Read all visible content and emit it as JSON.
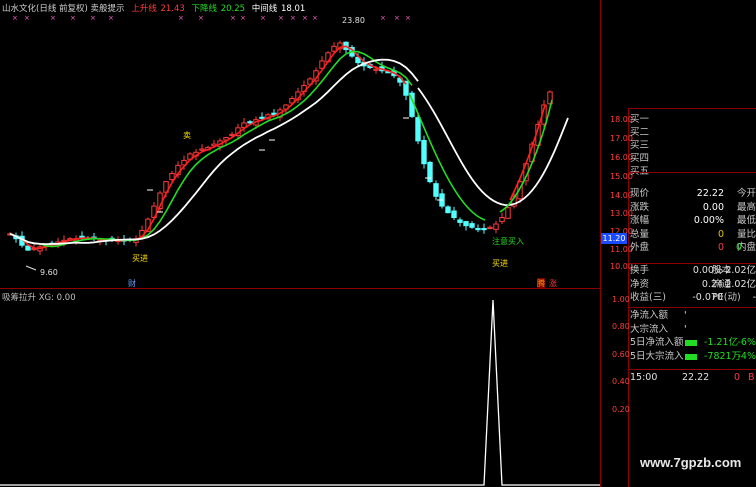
{
  "header": {
    "title": "山水文化(日线 前复权) 卖般提示",
    "upper_label": "上升线",
    "upper_value": "21.43",
    "lower_label": "下降线",
    "lower_value": "20.25",
    "mid_label": "中间线",
    "mid_value": "18.01"
  },
  "annotations": {
    "high": "23.80",
    "low": "9.60",
    "buy1": "买进",
    "buy2": "买进",
    "sell": "卖",
    "attention_buy": "注意买入",
    "fin": "财",
    "teng": "腾",
    "zhang": "涨"
  },
  "price_axis": {
    "ticks": [
      "18.00",
      "17.00",
      "16.00",
      "15.00",
      "14.00",
      "13.00",
      "12.00",
      "11.00",
      "10.00"
    ],
    "current_price_tag": "11.20"
  },
  "indicator": {
    "title": "吸筹拉升 XG: 0.00",
    "ticks": [
      "1.00",
      "0.80",
      "0.60",
      "0.40",
      "0.20"
    ]
  },
  "order_book": [
    {
      "label": "买一"
    },
    {
      "label": "买二"
    },
    {
      "label": "买三"
    },
    {
      "label": "买四"
    },
    {
      "label": "买五"
    }
  ],
  "quote": [
    {
      "k": "现价",
      "v": "22.22",
      "k2": "今开",
      "color": "#ffffff"
    },
    {
      "k": "涨跌",
      "v": "0.00",
      "k2": "最高",
      "color": "#ffffff"
    },
    {
      "k": "涨幅",
      "v": "0.00%",
      "k2": "最低",
      "color": "#ffffff"
    },
    {
      "k": "总量",
      "v": "0",
      "k2": "量比",
      "color": "#e6c200"
    },
    {
      "k": "外盘",
      "v": "0",
      "k2": "内盘",
      "color": "#ff3b3b",
      "v2": "0",
      "color2": "#22dd22"
    }
  ],
  "stats": [
    {
      "k": "换手",
      "v": "0.00%",
      "k2": "股本",
      "v2": "2.02亿"
    },
    {
      "k": "净资",
      "v": "0.24",
      "k2": "流通",
      "v2": "2.02亿"
    },
    {
      "k": "收益(三)",
      "v": "-0.070",
      "k2": "PE(动)",
      "v2": "-"
    }
  ],
  "fund_flow": [
    {
      "k": "净流入额",
      "v": "'",
      "pct": ""
    },
    {
      "k": "大宗流入",
      "v": "'",
      "pct": ""
    },
    {
      "k": "5日净流入额",
      "v": "-1.21亿",
      "pct": "-6%"
    },
    {
      "k": "5日大宗流入",
      "v": "-7821万",
      "pct": "-4%"
    }
  ],
  "last_trade": {
    "time": "15:00",
    "price": "22.22",
    "vol": "0",
    "side": "B"
  },
  "watermark": "www.7gpzb.com",
  "colors": {
    "up": "#ff3b3b",
    "down": "#54ffff",
    "ma_red": "#ff2020",
    "ma_green": "#22dd22",
    "ma_white": "#ffffff",
    "grid": "#8b0000"
  }
}
